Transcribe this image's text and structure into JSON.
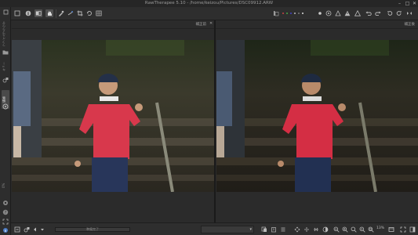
{
  "window": {
    "title": "RawTherapee 5.10 - /home/keizou/Pictures/DSC09912.ARW",
    "minimize": "–",
    "maximize": "□",
    "close": "✕"
  },
  "sidebar": {
    "tabs": [
      "ファイルブラウザ",
      "キュー",
      "編集"
    ],
    "zoom_label": "0%"
  },
  "panels": {
    "left_title": "補正前",
    "right_title": "補正後",
    "close_glyph": "✕"
  },
  "bottombar": {
    "status": "準備完了",
    "profile_combo": "",
    "zoom_value": "13%"
  },
  "icons": {
    "toolbar_left": [
      "hand-icon",
      "info-icon",
      "before-after-icon",
      "pan-icon",
      "color-picker-icon",
      "straighten-icon",
      "crop-icon",
      "rotate-icon",
      "grid-icon"
    ],
    "toolbar_right": [
      "histogram-icon",
      "clipping-warning-icon",
      "focus-mask-icon",
      "undo-icon",
      "redo-icon",
      "rotate-left-icon",
      "rotate-right-icon",
      "flip-h-icon",
      "flip-v-icon"
    ]
  },
  "colors": {
    "bg": "#2a2a2a",
    "accent": "#4d7cc4"
  }
}
